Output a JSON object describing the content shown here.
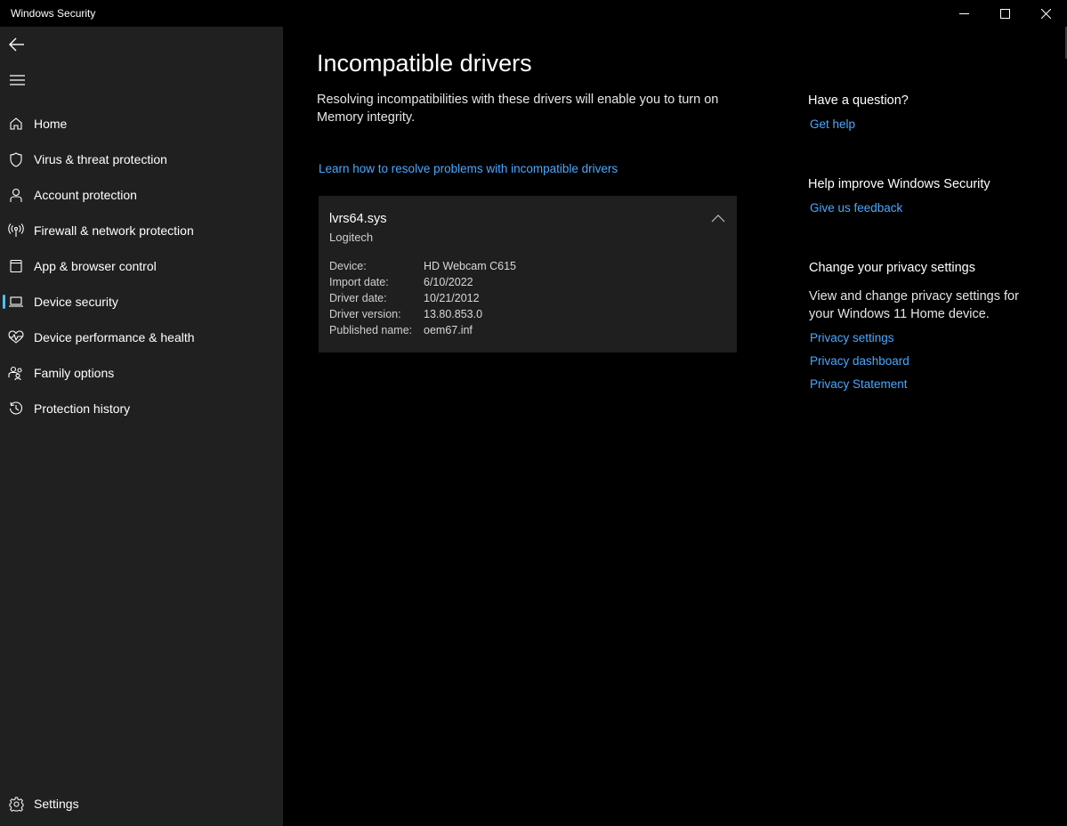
{
  "window": {
    "title": "Windows Security",
    "controls": {
      "minimize_icon": "minimize-icon",
      "maximize_icon": "maximize-icon",
      "close_icon": "close-icon"
    }
  },
  "sidebar": {
    "back_icon": "back-arrow-icon",
    "menu_icon": "hamburger-menu-icon",
    "items": [
      {
        "label": "Home",
        "icon": "home-icon",
        "active": false
      },
      {
        "label": "Virus & threat protection",
        "icon": "shield-icon",
        "active": false
      },
      {
        "label": "Account protection",
        "icon": "person-icon",
        "active": false
      },
      {
        "label": "Firewall & network protection",
        "icon": "antenna-icon",
        "active": false
      },
      {
        "label": "App & browser control",
        "icon": "app-window-icon",
        "active": false
      },
      {
        "label": "Device security",
        "icon": "laptop-icon",
        "active": true
      },
      {
        "label": "Device performance & health",
        "icon": "heart-pulse-icon",
        "active": false
      },
      {
        "label": "Family options",
        "icon": "family-icon",
        "active": false
      },
      {
        "label": "Protection history",
        "icon": "history-icon",
        "active": false
      }
    ],
    "settings": {
      "label": "Settings",
      "icon": "gear-icon"
    }
  },
  "main": {
    "title": "Incompatible drivers",
    "description": "Resolving incompatibilities with these drivers will enable you to turn on Memory integrity.",
    "learn_link": "Learn how to resolve problems with incompatible drivers",
    "driver": {
      "name": "lvrs64.sys",
      "vendor": "Logitech",
      "details": [
        {
          "key": "Device:",
          "value": "HD Webcam C615"
        },
        {
          "key": "Import date:",
          "value": "6/10/2022"
        },
        {
          "key": "Driver date:",
          "value": "10/21/2012"
        },
        {
          "key": "Driver version:",
          "value": "13.80.853.0"
        },
        {
          "key": "Published name:",
          "value": "oem67.inf"
        }
      ]
    }
  },
  "right_panel": {
    "question": {
      "heading": "Have a question?",
      "link": "Get help"
    },
    "improve": {
      "heading": "Help improve Windows Security",
      "link": "Give us feedback"
    },
    "privacy": {
      "heading": "Change your privacy settings",
      "text": "View and change privacy settings for your Windows 11 Home device.",
      "links": [
        "Privacy settings",
        "Privacy dashboard",
        "Privacy Statement"
      ]
    }
  },
  "colors": {
    "accent": "#4cc2ff",
    "link": "#4aa8ff",
    "sidebar_bg": "#202020",
    "card_bg": "#1f1f1f",
    "background": "#000000"
  }
}
